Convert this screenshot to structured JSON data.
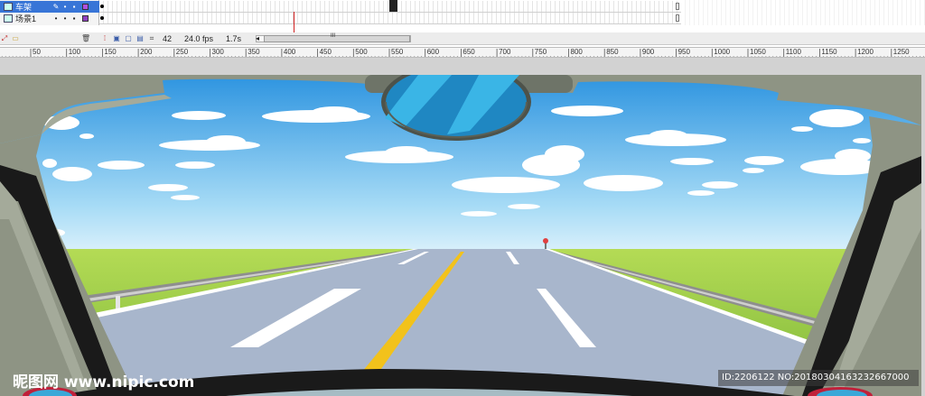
{
  "timeline": {
    "layers": [
      {
        "name": "车架",
        "selected": true
      },
      {
        "name": "场景1",
        "selected": false
      }
    ],
    "toolbar": {
      "frame": "42",
      "fps": "24.0 fps",
      "time": "1.7s",
      "scroll_grip": "III"
    }
  },
  "ruler": {
    "labels": [
      "50",
      "100",
      "150",
      "200",
      "250",
      "300",
      "350",
      "400",
      "450",
      "500",
      "550",
      "600",
      "650",
      "700",
      "750",
      "800",
      "850",
      "900",
      "950",
      "1000",
      "1050",
      "1100",
      "1150",
      "1200",
      "1250"
    ]
  },
  "watermark": {
    "left_text": "昵图网 www.nipic.com",
    "right_text": "ID:2206122 NO:20180304163232667000"
  },
  "colors": {
    "sky_top": "#2d94e0",
    "sky_bottom": "#d9f0fb",
    "grass": "#8cc540",
    "road": "#a8b6cc",
    "center_line": "#f2c21b",
    "car_frame": "#8e9484",
    "mirror_glass": "#1f87c2",
    "selection_blue": "#3875d7"
  }
}
